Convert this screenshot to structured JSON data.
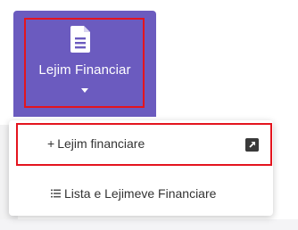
{
  "nav": {
    "label": "Lejim Financiar",
    "accent_color": "#6b5bbf",
    "icon": "document-icon",
    "caret_icon": "caret-down-icon"
  },
  "menu": {
    "items": [
      {
        "prefix": "+",
        "label": "Lejim financiare",
        "trailing_icon": "external-link-icon"
      },
      {
        "icon": "list-icon",
        "label": "Lista e Lejimeve Financiare"
      }
    ]
  },
  "highlight_color": "#e4141e"
}
